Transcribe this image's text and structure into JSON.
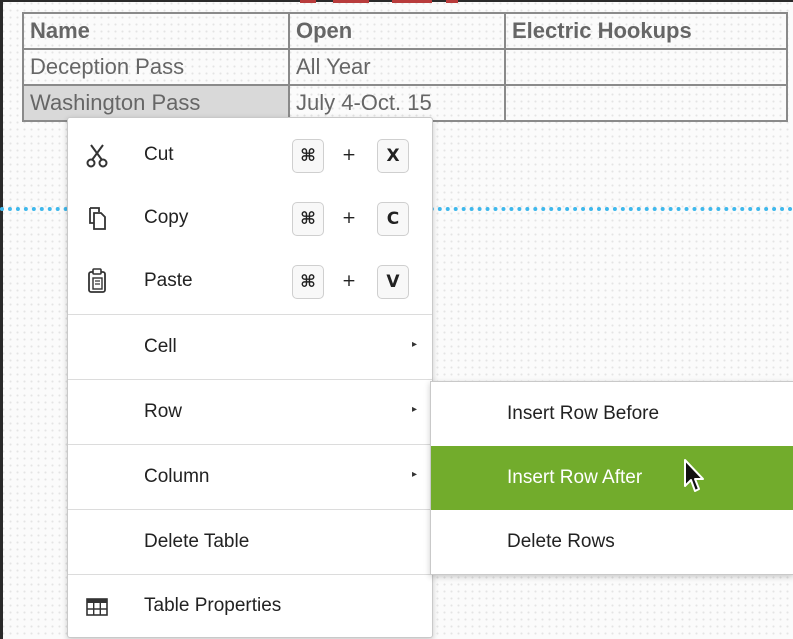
{
  "table": {
    "headers": [
      "Name",
      "Open",
      "Electric Hookups"
    ],
    "rows": [
      [
        "Deception Pass",
        "All Year",
        ""
      ],
      [
        "Washington Pass",
        "July 4-Oct. 15",
        ""
      ]
    ]
  },
  "context_menu": {
    "cut": {
      "label": "Cut",
      "keys": [
        "⌘",
        "X"
      ],
      "icon": "scissors-icon"
    },
    "copy": {
      "label": "Copy",
      "keys": [
        "⌘",
        "C"
      ],
      "icon": "copy-icon"
    },
    "paste": {
      "label": "Paste",
      "keys": [
        "⌘",
        "V"
      ],
      "icon": "clipboard-icon"
    },
    "plus": "+",
    "cell": {
      "label": "Cell",
      "arrow": "▸"
    },
    "row": {
      "label": "Row",
      "arrow": "▸"
    },
    "column": {
      "label": "Column",
      "arrow": "▸"
    },
    "delete_table": {
      "label": "Delete Table"
    },
    "table_properties": {
      "label": "Table Properties",
      "icon": "table-grid-icon"
    }
  },
  "row_submenu": {
    "items": [
      "Insert Row Before",
      "Insert Row After",
      "Delete Rows"
    ],
    "highlighted": "Insert Row After",
    "highlight_color": "#72ac2c"
  },
  "colors": {
    "guide_line": "#3fb8ec",
    "table_text": "#666666"
  }
}
